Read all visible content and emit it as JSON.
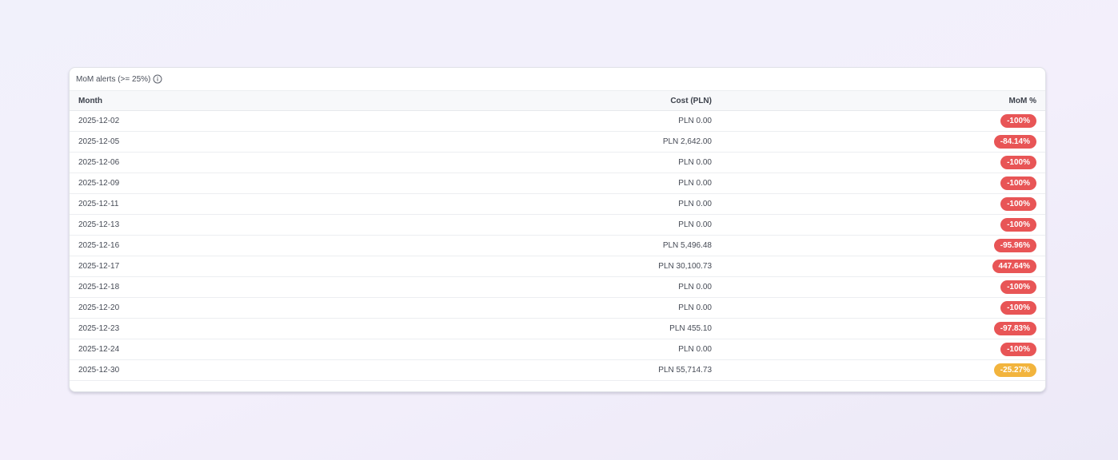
{
  "card": {
    "title": "MoM alerts (>= 25%)",
    "info_icon": "info-circle-icon"
  },
  "table": {
    "headers": {
      "month": "Month",
      "cost": "Cost (PLN)",
      "mom": "MoM %"
    },
    "rows": [
      {
        "month": "2025-12-02",
        "cost": "PLN 0.00",
        "mom": "-100%",
        "severity": "high"
      },
      {
        "month": "2025-12-05",
        "cost": "PLN 2,642.00",
        "mom": "-84.14%",
        "severity": "high"
      },
      {
        "month": "2025-12-06",
        "cost": "PLN 0.00",
        "mom": "-100%",
        "severity": "high"
      },
      {
        "month": "2025-12-09",
        "cost": "PLN 0.00",
        "mom": "-100%",
        "severity": "high"
      },
      {
        "month": "2025-12-11",
        "cost": "PLN 0.00",
        "mom": "-100%",
        "severity": "high"
      },
      {
        "month": "2025-12-13",
        "cost": "PLN 0.00",
        "mom": "-100%",
        "severity": "high"
      },
      {
        "month": "2025-12-16",
        "cost": "PLN 5,496.48",
        "mom": "-95.96%",
        "severity": "high"
      },
      {
        "month": "2025-12-17",
        "cost": "PLN 30,100.73",
        "mom": "447.64%",
        "severity": "high"
      },
      {
        "month": "2025-12-18",
        "cost": "PLN 0.00",
        "mom": "-100%",
        "severity": "high"
      },
      {
        "month": "2025-12-20",
        "cost": "PLN 0.00",
        "mom": "-100%",
        "severity": "high"
      },
      {
        "month": "2025-12-23",
        "cost": "PLN 455.10",
        "mom": "-97.83%",
        "severity": "high"
      },
      {
        "month": "2025-12-24",
        "cost": "PLN 0.00",
        "mom": "-100%",
        "severity": "high"
      },
      {
        "month": "2025-12-30",
        "cost": "PLN 55,714.73",
        "mom": "-25.27%",
        "severity": "medium"
      }
    ]
  },
  "colors": {
    "high": "#e85556",
    "medium": "#f2b43d"
  }
}
